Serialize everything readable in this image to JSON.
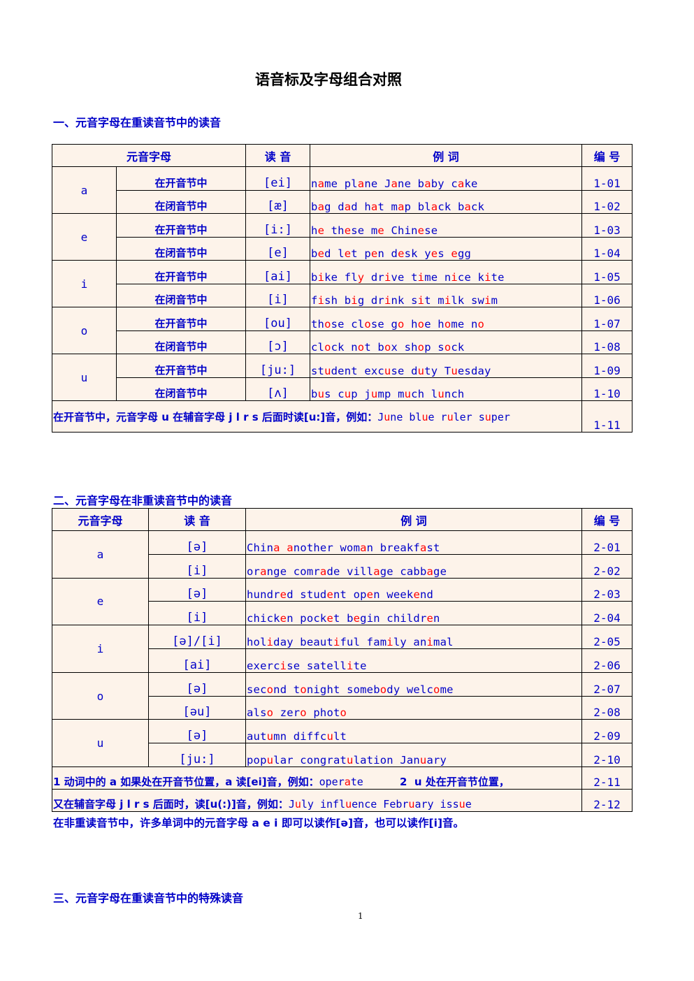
{
  "document": {
    "title": "语音标及字母组合对照",
    "page_number": "1"
  },
  "section1": {
    "heading": "一、元音字母在重读音节中的读音",
    "headers": {
      "letter": "元音字母",
      "sound": "读 音",
      "examples": "例 词",
      "number": "编 号"
    },
    "groups": [
      {
        "letter": "a",
        "rows": [
          {
            "syllable": "在开音节中",
            "ipa": "[ei]",
            "examples": [
              [
                "n",
                "a",
                "me"
              ],
              [
                " pl",
                "a",
                "ne"
              ],
              [
                " J",
                "a",
                "ne"
              ],
              [
                " b",
                "a",
                "by"
              ],
              [
                " c",
                "a",
                "ke"
              ]
            ],
            "number": "1-01"
          },
          {
            "syllable": "在闭音节中",
            "ipa": "[æ]",
            "examples": [
              [
                "b",
                "a",
                "g"
              ],
              [
                " d",
                "a",
                "d"
              ],
              [
                " h",
                "a",
                "t"
              ],
              [
                " m",
                "a",
                "p"
              ],
              [
                " bl",
                "a",
                "ck"
              ],
              [
                " b",
                "a",
                "ck"
              ]
            ],
            "number": "1-02"
          }
        ]
      },
      {
        "letter": "e",
        "rows": [
          {
            "syllable": "在开音节中",
            "ipa": "[i:]",
            "examples": [
              [
                "h",
                "e",
                ""
              ],
              [
                " th",
                "e",
                "se"
              ],
              [
                " m",
                "e",
                ""
              ],
              [
                " Chin",
                "e",
                "se"
              ]
            ],
            "number": "1-03"
          },
          {
            "syllable": "在闭音节中",
            "ipa": "[e]",
            "examples": [
              [
                "b",
                "e",
                "d"
              ],
              [
                " l",
                "e",
                "t"
              ],
              [
                " p",
                "e",
                "n"
              ],
              [
                " d",
                "e",
                "sk"
              ],
              [
                " y",
                "e",
                "s"
              ],
              [
                " ",
                "e",
                "gg"
              ]
            ],
            "number": "1-04"
          }
        ]
      },
      {
        "letter": "i",
        "rows": [
          {
            "syllable": "在开音节中",
            "ipa": "[ai]",
            "examples": [
              [
                "b",
                "i",
                "ke"
              ],
              [
                " fl",
                "y",
                ""
              ],
              [
                " dr",
                "i",
                "ve"
              ],
              [
                " t",
                "i",
                "me"
              ],
              [
                " n",
                "i",
                "ce"
              ],
              [
                " k",
                "i",
                "te"
              ]
            ],
            "number": "1-05"
          },
          {
            "syllable": "在闭音节中",
            "ipa": "[i]",
            "examples": [
              [
                "f",
                "i",
                "sh"
              ],
              [
                " b",
                "i",
                "g"
              ],
              [
                " dr",
                "i",
                "nk"
              ],
              [
                " s",
                "i",
                "t"
              ],
              [
                " m",
                "i",
                "lk"
              ],
              [
                " sw",
                "i",
                "m"
              ]
            ],
            "number": "1-06"
          }
        ]
      },
      {
        "letter": "o",
        "rows": [
          {
            "syllable": "在开音节中",
            "ipa": "[ou]",
            "examples": [
              [
                "th",
                "o",
                "se"
              ],
              [
                " cl",
                "o",
                "se"
              ],
              [
                " g",
                "o",
                ""
              ],
              [
                " h",
                "o",
                "e"
              ],
              [
                " h",
                "o",
                "me"
              ],
              [
                " n",
                "o",
                ""
              ]
            ],
            "number": "1-07"
          },
          {
            "syllable": "在闭音节中",
            "ipa": "[ɔ]",
            "examples": [
              [
                "cl",
                "o",
                "ck"
              ],
              [
                " n",
                "o",
                "t"
              ],
              [
                " b",
                "o",
                "x"
              ],
              [
                " sh",
                "o",
                "p"
              ],
              [
                " s",
                "o",
                "ck"
              ]
            ],
            "number": "1-08"
          }
        ]
      },
      {
        "letter": "u",
        "rows": [
          {
            "syllable": "在开音节中",
            "ipa": "[ju:]",
            "examples": [
              [
                "st",
                "u",
                "dent"
              ],
              [
                " exc",
                "u",
                "se"
              ],
              [
                " d",
                "u",
                "ty"
              ],
              [
                " T",
                "u",
                "esday"
              ]
            ],
            "number": "1-09"
          },
          {
            "syllable": "在闭音节中",
            "ipa": "[ʌ]",
            "examples": [
              [
                "b",
                "u",
                "s"
              ],
              [
                " c",
                "u",
                "p"
              ],
              [
                " j",
                "u",
                "mp"
              ],
              [
                " m",
                "u",
                "ch"
              ],
              [
                " l",
                "u",
                "nch"
              ]
            ],
            "number": "1-10"
          }
        ]
      }
    ],
    "note_row": {
      "text": "在开音节中，元音字母 u 在辅音字母 j l r s 后面时读[u:]音，例如：",
      "examples": [
        [
          "J",
          "u",
          "ne"
        ],
        [
          " bl",
          "u",
          "e"
        ],
        [
          " r",
          "u",
          "ler"
        ],
        [
          " s",
          "u",
          "per"
        ]
      ],
      "number": "1-11"
    }
  },
  "section2": {
    "heading": "二、元音字母在非重读音节中的读音",
    "headers": {
      "letter": "元音字母",
      "sound": "读 音",
      "examples": "例 词",
      "number": "编 号"
    },
    "groups": [
      {
        "letter": "a",
        "rows": [
          {
            "ipa": "[ə]",
            "examples": [
              [
                "Chin",
                "a",
                ""
              ],
              [
                " ",
                "a",
                "nother"
              ],
              [
                " wom",
                "a",
                "n"
              ],
              [
                " breakf",
                "a",
                "st"
              ]
            ],
            "number": "2-01"
          },
          {
            "ipa": "[i]",
            "examples": [
              [
                "or",
                "a",
                "nge"
              ],
              [
                " comr",
                "a",
                "de"
              ],
              [
                " vill",
                "a",
                "ge"
              ],
              [
                " cabb",
                "a",
                "ge"
              ]
            ],
            "number": "2-02"
          }
        ]
      },
      {
        "letter": "e",
        "rows": [
          {
            "ipa": "[ə]",
            "examples": [
              [
                "hundr",
                "e",
                "d"
              ],
              [
                " stud",
                "e",
                "nt"
              ],
              [
                " op",
                "e",
                "n"
              ],
              [
                " week",
                "e",
                "nd"
              ]
            ],
            "number": "2-03"
          },
          {
            "ipa": "[i]",
            "examples": [
              [
                "chick",
                "e",
                "n"
              ],
              [
                " pock",
                "e",
                "t"
              ],
              [
                " b",
                "e",
                "gin"
              ],
              [
                " childr",
                "e",
                "n"
              ]
            ],
            "number": "2-04"
          }
        ]
      },
      {
        "letter": "i",
        "rows": [
          {
            "ipa": "[ə]/[i]",
            "examples": [
              [
                "hol",
                "i",
                "day"
              ],
              [
                " beaut",
                "i",
                "ful"
              ],
              [
                " fam",
                "i",
                "ly"
              ],
              [
                " an",
                "i",
                "mal"
              ]
            ],
            "number": "2-05"
          },
          {
            "ipa": "[ai]",
            "examples": [
              [
                "exerc",
                "i",
                "se"
              ],
              [
                " satell",
                "i",
                "te"
              ]
            ],
            "number": "2-06"
          }
        ]
      },
      {
        "letter": "o",
        "rows": [
          {
            "ipa": "[ə]",
            "examples": [
              [
                "sec",
                "o",
                "nd"
              ],
              [
                " t",
                "o",
                "night"
              ],
              [
                " someb",
                "o",
                "dy"
              ],
              [
                " welc",
                "o",
                "me"
              ]
            ],
            "number": "2-07"
          },
          {
            "ipa": "[əu]",
            "examples": [
              [
                "als",
                "o",
                ""
              ],
              [
                " zer",
                "o",
                ""
              ],
              [
                " phot",
                "o",
                ""
              ]
            ],
            "number": "2-08"
          }
        ]
      },
      {
        "letter": "u",
        "rows": [
          {
            "ipa": "[ə]",
            "examples": [
              [
                "aut",
                "u",
                "mn"
              ],
              [
                " diffc",
                "u",
                "lt"
              ]
            ],
            "number": "2-09"
          },
          {
            "ipa": "[ju:]",
            "examples": [
              [
                "pop",
                "u",
                "lar"
              ],
              [
                " congrat",
                "u",
                "lation"
              ],
              [
                " Jan",
                "u",
                "ary"
              ]
            ],
            "number": "2-10"
          }
        ]
      }
    ],
    "note_rows": [
      {
        "text_before": "1 动词中的 a 如果处在开音节位置，a 读[ei]音，例如：",
        "examples": [
          [
            "oper",
            "a",
            "te"
          ]
        ],
        "text_after": "          2  u 处在开音节位置，",
        "number": "2-11"
      },
      {
        "text_before": "又在辅音字母 j l r s 后面时，读[u(:)]音，例如：",
        "examples": [
          [
            "J",
            "u",
            "ly"
          ],
          [
            " infl",
            "u",
            "ence"
          ],
          [
            " Febr",
            "u",
            "ary"
          ],
          [
            " iss",
            "u",
            "e"
          ]
        ],
        "text_after": "",
        "number": "2-12"
      }
    ],
    "footnote": "在非重读音节中，许多单词中的元音字母 a e i 即可以读作[ə]音，也可以读作[i]音。"
  },
  "section3": {
    "heading": "三、元音字母在重读音节中的特殊读音"
  },
  "colors": {
    "text": "#0000c8",
    "highlight": "#ff0000",
    "table_bg": "#fdf3ea"
  }
}
